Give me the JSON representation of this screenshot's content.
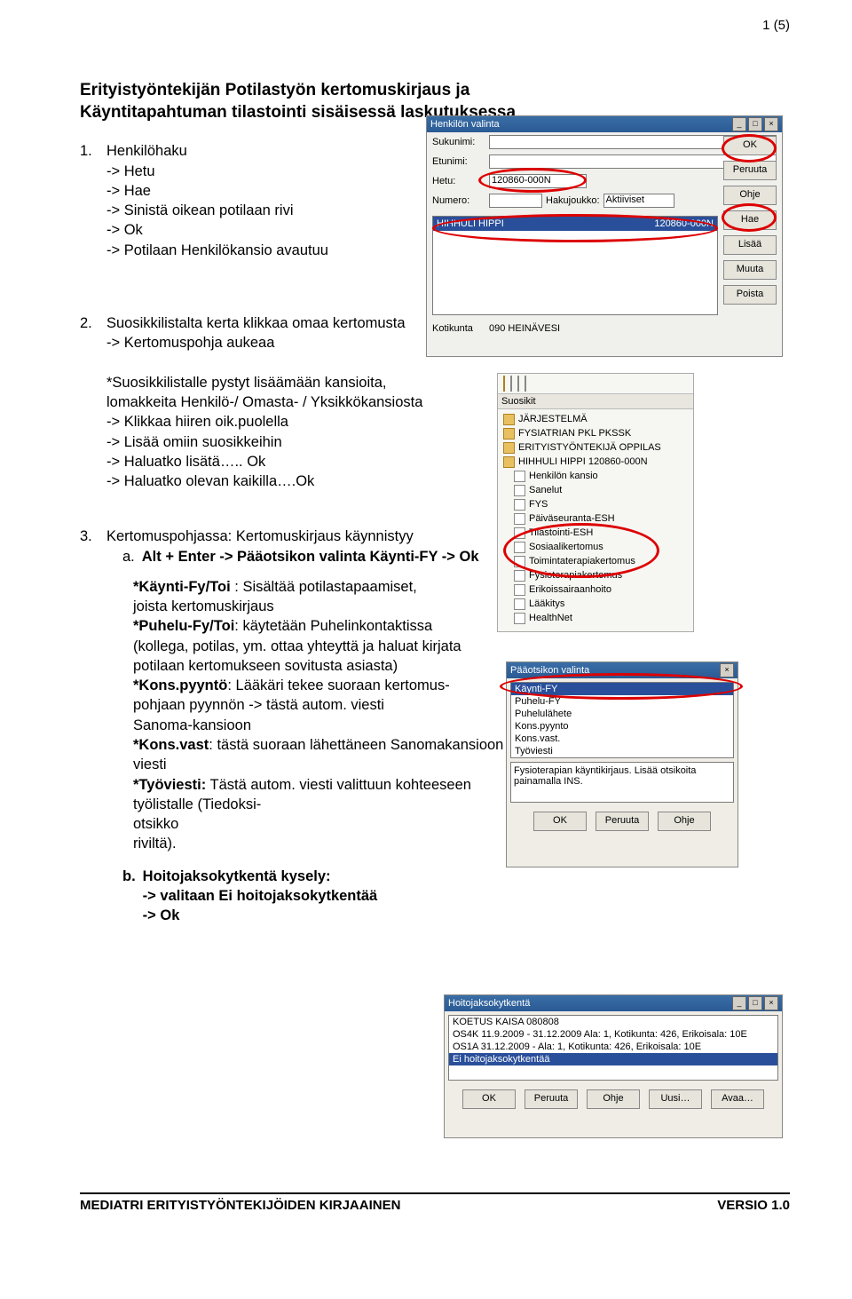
{
  "page_number": "1 (5)",
  "title": "Erityistyöntekijän Potilastyön kertomuskirjaus ja Käyntitapahtuman tilastointi sisäisessä laskutuksessa",
  "sec1": {
    "num": "1.",
    "head": "Henkilöhaku",
    "l1": "-> Hetu",
    "l2": "-> Hae",
    "l3": "-> Sinistä oikean potilaan rivi",
    "l4": "-> Ok",
    "l5": "-> Potilaan Henkilökansio avautuu"
  },
  "sec2": {
    "num": "2.",
    "head": "Suosikkilistalta kerta klikkaa omaa kertomusta",
    "l1": "-> Kertomuspohja aukeaa",
    "p1": "*Suosikkilistalle pystyt lisäämään kansioita,",
    "p2": "lomakkeita Henkilö-/ Omasta- / Yksikkökansiosta",
    "p3": "-> Klikkaa hiiren oik.puolella",
    "p4": "-> Lisää omiin suosikkeihin",
    "p5": "-> Haluatko lisätä….. Ok",
    "p6": "-> Haluatko olevan kaikilla….Ok"
  },
  "sec3": {
    "num": "3.",
    "head": "Kertomuspohjassa: Kertomuskirjaus käynnistyy",
    "a_label": "a.",
    "a_text": "Alt + Enter -> Pääotsikon valinta Käynti-FY -> Ok",
    "p1a": "*Käynti-Fy/Toi",
    "p1b": " : Sisältää potilastapaamiset,",
    "p2": "  joista kertomuskirjaus",
    "p3a": "*Puhelu-Fy/Toi",
    "p3b": ": käytetään Puhelinkontaktissa",
    "p4": "(kollega, potilas, ym. ottaa yhteyttä ja haluat kirjata",
    "p5": "potilaan kertomukseen sovitusta asiasta)",
    "p6a": "*Kons.pyyntö",
    "p6b": ": Lääkäri tekee suoraan kertomus-",
    "p7": "pohjaan pyynnön -> tästä autom. viesti",
    "p8": "Sanoma-kansioon",
    "p9a": "*Kons.vast",
    "p9b": ": tästä suoraan lähettäneen Sanomakansioon viesti",
    "p10a": "*Työviesti:",
    "p10b": " Tästä autom. viesti valittuun kohteeseen työlistalle (Tiedoksi-",
    "p11": "otsikko",
    "p12": "  riviltä).",
    "b_label": "b.",
    "b_head": "Hoitojaksokytkentä kysely:",
    "b1": "-> valitaan Ei hoitojaksokytkentää",
    "b2": "-> Ok"
  },
  "scr1": {
    "title": "Henkilön valinta",
    "lbl_suku": "Sukunimi:",
    "lbl_etu": "Etunimi:",
    "lbl_hetu": "Hetu:",
    "lbl_num": "Numero:",
    "val_hetu": "120860-000N",
    "lbl_haku": "Hakujoukko:",
    "val_haku": "Aktiiviset",
    "row_name": "HIHHULI HIPPI",
    "row_hetu": "120860-000N",
    "lbl_koti": "Kotikunta",
    "val_koti": "090 HEINÄVESI",
    "btn_ok": "OK",
    "btn_peruuta": "Peruuta",
    "btn_ohje": "Ohje",
    "btn_hae": "Hae",
    "btn_lisaa": "Lisää",
    "btn_muuta": "Muuta",
    "btn_poista": "Poista"
  },
  "scr2": {
    "hdr": "Suosikit",
    "i0": "JÄRJESTELMÄ",
    "i1": "FYSIATRIAN PKL PKSSK",
    "i2": "ERITYISTYÖNTEKIJÄ OPPILAS",
    "i3": "HIHHULI HIPPI 120860-000N",
    "i4": "Henkilön kansio",
    "i5": "Sanelut",
    "i6": "FYS",
    "i7": "Päiväseuranta-ESH",
    "i8": "Tilastointi-ESH",
    "i9": "Sosiaalikertomus",
    "i10": "Toimintaterapiakertomus",
    "i11": "Fysioterapiakertomus",
    "i12": "Erikoissairaanhoito",
    "i13": "Lääkitys",
    "i14": "HealthNet"
  },
  "scr3": {
    "title": "Pääotsikon valinta",
    "o0": "Käynti-FY",
    "o1": "Puhelu-FY",
    "o2": "Puhelulähete",
    "o3": "Kons.pyynto",
    "o4": "Kons.vast.",
    "o5": "Työviesti",
    "note": "Fysioterapian käyntikirjaus. Lisää otsikoita painamalla INS.",
    "btn_ok": "OK",
    "btn_peruuta": "Peruuta",
    "btn_ohje": "Ohje"
  },
  "scr4": {
    "title": "Hoitojaksokytkentä",
    "r0": "KOETUS KAISA  080808",
    "r1": "OS4K 11.9.2009 - 31.12.2009 Ala: 1, Kotikunta: 426, Erikoisala: 10E",
    "r2": "OS1A 31.12.2009 - Ala: 1, Kotikunta: 426, Erikoisala: 10E",
    "r3": "Ei hoitojaksokytkentää",
    "btn_ok": "OK",
    "btn_peruuta": "Peruuta",
    "btn_ohje": "Ohje",
    "btn_uusi": "Uusi…",
    "btn_avaa": "Avaa…"
  },
  "footer_left": "MEDIATRI ERITYISTYÖNTEKIJÖIDEN KIRJAAINEN",
  "footer_right": "VERSIO 1.0"
}
